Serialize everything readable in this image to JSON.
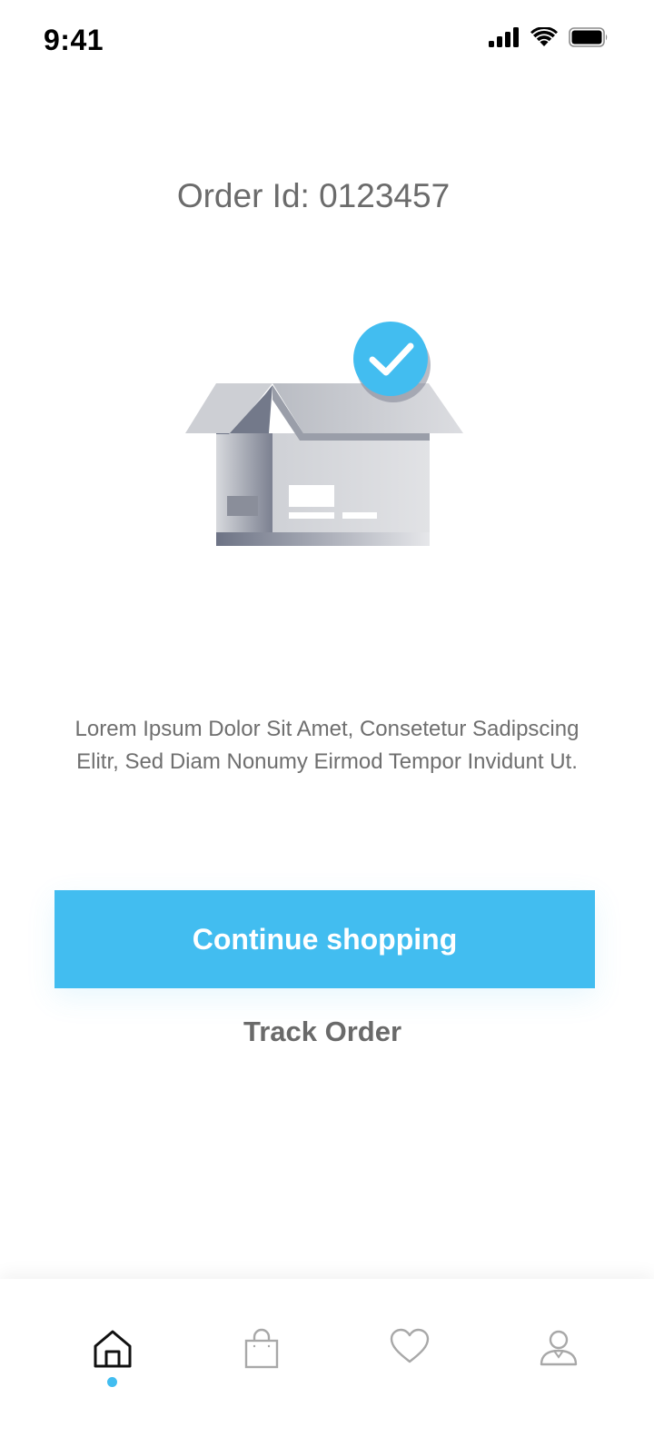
{
  "status_bar": {
    "time": "9:41",
    "signal_icon": "cellular-signal-icon",
    "wifi_icon": "wifi-icon",
    "battery_icon": "battery-icon"
  },
  "order": {
    "id_label": "Order Id: 0123457"
  },
  "illustration": {
    "icon": "open-box-with-checkmark-illustration",
    "check_color": "#42bdf0"
  },
  "message": "Lorem Ipsum Dolor Sit Amet, Consetetur Sadipscing Elitr, Sed Diam Nonumy Eirmod Tempor Invidunt Ut.",
  "actions": {
    "continue_label": "Continue shopping",
    "track_label": "Track Order"
  },
  "colors": {
    "accent": "#42bdf0",
    "text_gray": "#6b6b6b"
  },
  "bottom_nav": {
    "items": [
      {
        "icon": "home-icon",
        "active": true
      },
      {
        "icon": "shopping-bag-icon",
        "active": false
      },
      {
        "icon": "heart-icon",
        "active": false
      },
      {
        "icon": "user-icon",
        "active": false
      }
    ]
  }
}
